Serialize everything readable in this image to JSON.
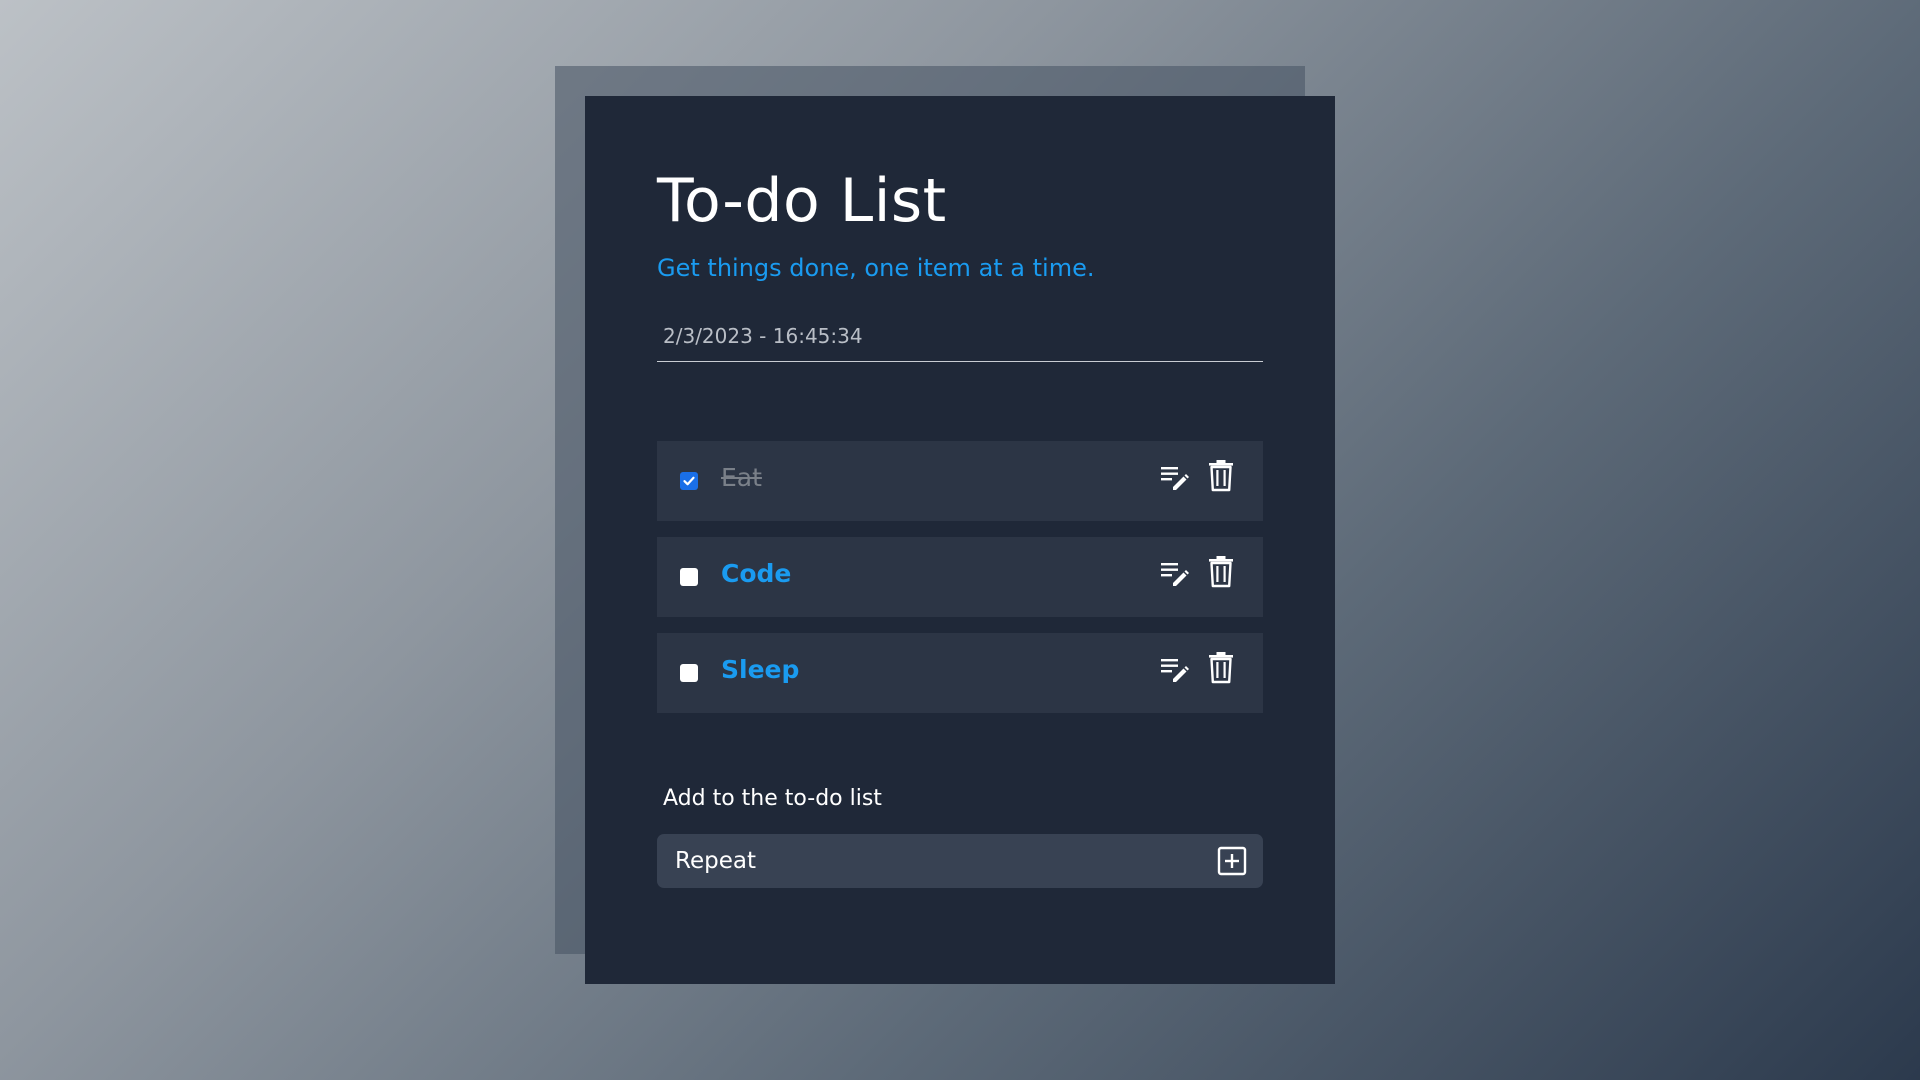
{
  "header": {
    "title": "To-do List",
    "subtitle": "Get things done, one item at a time.",
    "datetime": "2/3/2023 - 16:45:34"
  },
  "todos": [
    {
      "text": "Eat",
      "done": true
    },
    {
      "text": "Code",
      "done": false
    },
    {
      "text": "Sleep",
      "done": false
    }
  ],
  "add_form": {
    "label": "Add to the to-do list",
    "input_value": "Repeat"
  },
  "colors": {
    "accent": "#1a9bf0",
    "card_bg": "#1f2838",
    "item_bg": "#2c3545",
    "input_bg": "#384253",
    "checkbox_checked": "#1a6fe8"
  },
  "icons": {
    "edit": "edit-list-icon",
    "delete": "trash-icon",
    "add": "plus-square-icon",
    "check": "checkmark-icon"
  }
}
